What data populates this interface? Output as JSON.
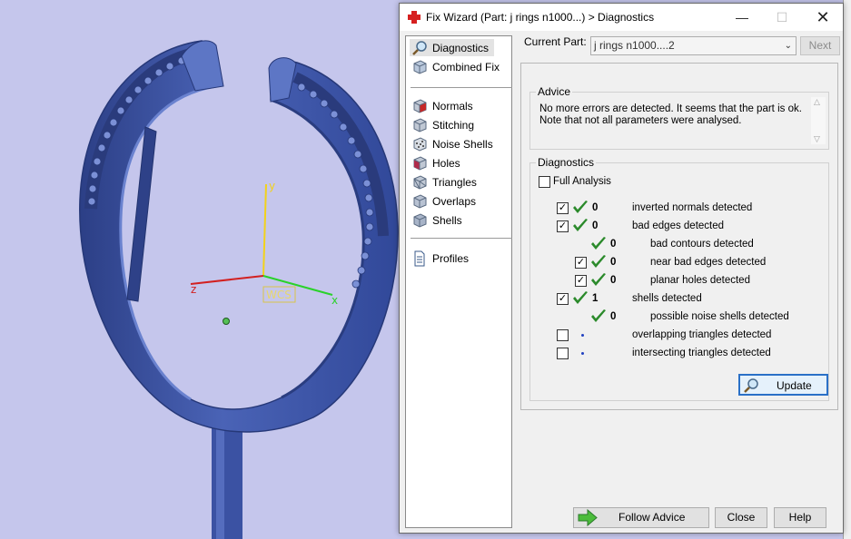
{
  "viewport": {
    "axes": {
      "x": "x",
      "y": "y",
      "z": "z",
      "wcs": "WCS"
    },
    "background": "#c5c6ec",
    "model_color": "#3c55a8"
  },
  "dialog": {
    "title": "Fix Wizard (Part: j rings n1000...) > Diagnostics",
    "window_buttons": {
      "minimize": "—",
      "maximize": "☐",
      "close": "✕"
    }
  },
  "nav": {
    "items": [
      {
        "label": "Diagnostics",
        "icon": "magnifier-icon",
        "active": true
      },
      {
        "label": "Combined Fix",
        "icon": "cube-icon"
      },
      {
        "label": "Normals",
        "icon": "normals-cube-icon"
      },
      {
        "label": "Stitching",
        "icon": "stitching-cube-icon"
      },
      {
        "label": "Noise Shells",
        "icon": "noise-shells-icon"
      },
      {
        "label": "Holes",
        "icon": "holes-cube-icon"
      },
      {
        "label": "Triangles",
        "icon": "triangles-cube-icon"
      },
      {
        "label": "Overlaps",
        "icon": "overlaps-cube-icon"
      },
      {
        "label": "Shells",
        "icon": "shells-cube-icon"
      },
      {
        "label": "Profiles",
        "icon": "document-icon"
      }
    ]
  },
  "current_part": {
    "label": "Current Part:",
    "value": "j rings n1000....2"
  },
  "next_button": "Next",
  "advice": {
    "title": "Advice",
    "text": "No more errors are detected. It seems that the part is ok. Note that not all parameters were analysed."
  },
  "diagnostics": {
    "title": "Diagnostics",
    "full_analysis": {
      "label": "Full Analysis",
      "checked": false
    },
    "rows": [
      {
        "checkbox": "checked",
        "status": "ok",
        "count": "0",
        "label": "inverted normals detected",
        "indent": 0
      },
      {
        "checkbox": "checked",
        "status": "ok",
        "count": "0",
        "label": "bad edges detected",
        "indent": 0
      },
      {
        "checkbox": "none",
        "status": "ok",
        "count": "0",
        "label": "bad contours detected",
        "indent": 1
      },
      {
        "checkbox": "checked",
        "status": "ok",
        "count": "0",
        "label": "near bad edges detected",
        "indent": 1
      },
      {
        "checkbox": "checked",
        "status": "ok",
        "count": "0",
        "label": "planar holes detected",
        "indent": 1
      },
      {
        "checkbox": "checked",
        "status": "ok",
        "count": "1",
        "label": "shells detected",
        "indent": 0
      },
      {
        "checkbox": "none",
        "status": "ok",
        "count": "0",
        "label": "possible noise shells detected",
        "indent": 1
      },
      {
        "checkbox": "unchecked",
        "status": "pending",
        "count": "",
        "label": "overlapping triangles detected",
        "indent": 0
      },
      {
        "checkbox": "unchecked",
        "status": "pending",
        "count": "",
        "label": "intersecting triangles detected",
        "indent": 0
      }
    ],
    "update_button": "Update"
  },
  "buttons": {
    "follow_advice": "Follow Advice",
    "close": "Close",
    "help": "Help"
  },
  "colors": {
    "check_green": "#2b8a2b",
    "accent_blue": "#2a70c7",
    "title_icon_red": "#d62020"
  }
}
